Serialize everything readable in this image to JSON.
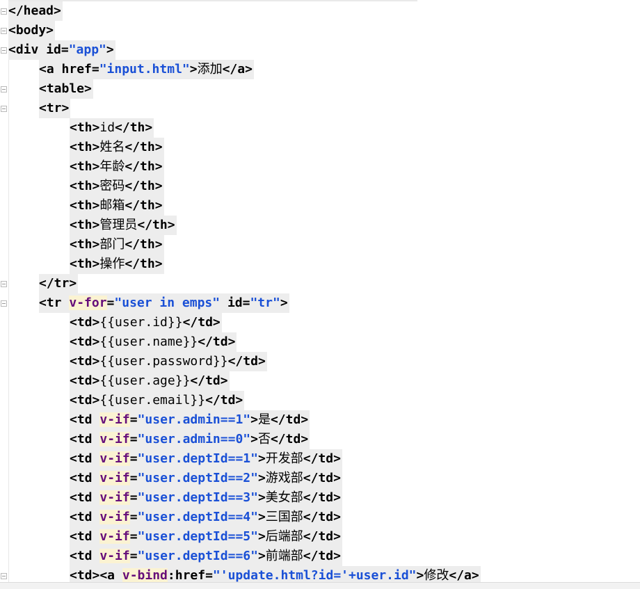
{
  "lines": [
    {
      "indent": 0,
      "parts": [
        [
          "tagk",
          "</head>"
        ]
      ]
    },
    {
      "indent": 0,
      "parts": [
        [
          "tagk",
          "<body>"
        ]
      ]
    },
    {
      "indent": 0,
      "parts": [
        [
          "tagk",
          "<div "
        ],
        [
          "tagk",
          "id="
        ],
        [
          "strb",
          "\"app\""
        ],
        [
          "tagk",
          ">"
        ]
      ]
    },
    {
      "indent": 1,
      "parts": [
        [
          "tagk",
          "<a "
        ],
        [
          "tagk",
          "href="
        ],
        [
          "strb",
          "\"input.html\""
        ],
        [
          "tagk",
          ">"
        ],
        [
          "txt",
          "添加"
        ],
        [
          "tagk",
          "</a>"
        ]
      ]
    },
    {
      "indent": 1,
      "parts": [
        [
          "tagk",
          "<table>"
        ]
      ]
    },
    {
      "indent": 1,
      "parts": [
        [
          "tagk",
          "<tr>"
        ]
      ]
    },
    {
      "indent": 2,
      "parts": [
        [
          "tagk",
          "<th>"
        ],
        [
          "txt",
          "id"
        ],
        [
          "tagk",
          "</th>"
        ]
      ]
    },
    {
      "indent": 2,
      "parts": [
        [
          "tagk",
          "<th>"
        ],
        [
          "txt",
          "姓名"
        ],
        [
          "tagk",
          "</th>"
        ]
      ]
    },
    {
      "indent": 2,
      "parts": [
        [
          "tagk",
          "<th>"
        ],
        [
          "txt",
          "年龄"
        ],
        [
          "tagk",
          "</th>"
        ]
      ]
    },
    {
      "indent": 2,
      "parts": [
        [
          "tagk",
          "<th>"
        ],
        [
          "txt",
          "密码"
        ],
        [
          "tagk",
          "</th>"
        ]
      ]
    },
    {
      "indent": 2,
      "parts": [
        [
          "tagk",
          "<th>"
        ],
        [
          "txt",
          "邮箱"
        ],
        [
          "tagk",
          "</th>"
        ]
      ]
    },
    {
      "indent": 2,
      "parts": [
        [
          "tagk",
          "<th>"
        ],
        [
          "txt",
          "管理员"
        ],
        [
          "tagk",
          "</th>"
        ]
      ]
    },
    {
      "indent": 2,
      "parts": [
        [
          "tagk",
          "<th>"
        ],
        [
          "txt",
          "部门"
        ],
        [
          "tagk",
          "</th>"
        ]
      ]
    },
    {
      "indent": 2,
      "parts": [
        [
          "tagk",
          "<th>"
        ],
        [
          "txt",
          "操作"
        ],
        [
          "tagk",
          "</th>"
        ]
      ]
    },
    {
      "indent": 1,
      "parts": [
        [
          "tagk",
          "</tr>"
        ]
      ]
    },
    {
      "indent": 1,
      "parts": [
        [
          "tagk",
          "<tr "
        ],
        [
          "vattr",
          "v-for"
        ],
        [
          "tagk",
          "="
        ],
        [
          "strb",
          "\"user in emps\""
        ],
        [
          "tagk",
          " id="
        ],
        [
          "strb",
          "\"tr\""
        ],
        [
          "tagk",
          ">"
        ]
      ]
    },
    {
      "indent": 2,
      "parts": [
        [
          "tagk",
          "<td>"
        ],
        [
          "txt",
          "{{user.id}}"
        ],
        [
          "tagk",
          "</td>"
        ]
      ]
    },
    {
      "indent": 2,
      "parts": [
        [
          "tagk",
          "<td>"
        ],
        [
          "txt",
          "{{user.name}}"
        ],
        [
          "tagk",
          "</td>"
        ]
      ]
    },
    {
      "indent": 2,
      "parts": [
        [
          "tagk",
          "<td>"
        ],
        [
          "txt",
          "{{user.password}}"
        ],
        [
          "tagk",
          "</td>"
        ]
      ]
    },
    {
      "indent": 2,
      "parts": [
        [
          "tagk",
          "<td>"
        ],
        [
          "txt",
          "{{user.age}}"
        ],
        [
          "tagk",
          "</td>"
        ]
      ]
    },
    {
      "indent": 2,
      "parts": [
        [
          "tagk",
          "<td>"
        ],
        [
          "txt",
          "{{user.email}}"
        ],
        [
          "tagk",
          "</td>"
        ]
      ]
    },
    {
      "indent": 2,
      "parts": [
        [
          "tagk",
          "<td "
        ],
        [
          "vattr",
          "v-if"
        ],
        [
          "tagk",
          "="
        ],
        [
          "strb",
          "\"user.admin==1\""
        ],
        [
          "tagk",
          ">"
        ],
        [
          "txt",
          "是"
        ],
        [
          "tagk",
          "</td>"
        ]
      ]
    },
    {
      "indent": 2,
      "parts": [
        [
          "tagk",
          "<td "
        ],
        [
          "vattr",
          "v-if"
        ],
        [
          "tagk",
          "="
        ],
        [
          "strb",
          "\"user.admin==0\""
        ],
        [
          "tagk",
          ">"
        ],
        [
          "txt",
          "否"
        ],
        [
          "tagk",
          "</td>"
        ]
      ]
    },
    {
      "indent": 2,
      "parts": [
        [
          "tagk",
          "<td "
        ],
        [
          "vattr",
          "v-if"
        ],
        [
          "tagk",
          "="
        ],
        [
          "strb",
          "\"user.deptId==1\""
        ],
        [
          "tagk",
          ">"
        ],
        [
          "txt",
          "开发部"
        ],
        [
          "tagk",
          "</td>"
        ]
      ]
    },
    {
      "indent": 2,
      "parts": [
        [
          "tagk",
          "<td "
        ],
        [
          "vattr",
          "v-if"
        ],
        [
          "tagk",
          "="
        ],
        [
          "strb",
          "\"user.deptId==2\""
        ],
        [
          "tagk",
          ">"
        ],
        [
          "txt",
          "游戏部"
        ],
        [
          "tagk",
          "</td>"
        ]
      ]
    },
    {
      "indent": 2,
      "parts": [
        [
          "tagk",
          "<td "
        ],
        [
          "vattr",
          "v-if"
        ],
        [
          "tagk",
          "="
        ],
        [
          "strb",
          "\"user.deptId==3\""
        ],
        [
          "tagk",
          ">"
        ],
        [
          "txt",
          "美女部"
        ],
        [
          "tagk",
          "</td>"
        ]
      ]
    },
    {
      "indent": 2,
      "parts": [
        [
          "tagk",
          "<td "
        ],
        [
          "vattr",
          "v-if"
        ],
        [
          "tagk",
          "="
        ],
        [
          "strb",
          "\"user.deptId==4\""
        ],
        [
          "tagk",
          ">"
        ],
        [
          "txt",
          "三国部"
        ],
        [
          "tagk",
          "</td>"
        ]
      ]
    },
    {
      "indent": 2,
      "parts": [
        [
          "tagk",
          "<td "
        ],
        [
          "vattr",
          "v-if"
        ],
        [
          "tagk",
          "="
        ],
        [
          "strb",
          "\"user.deptId==5\""
        ],
        [
          "tagk",
          ">"
        ],
        [
          "txt",
          "后端部"
        ],
        [
          "tagk",
          "</td>"
        ]
      ]
    },
    {
      "indent": 2,
      "parts": [
        [
          "tagk",
          "<td "
        ],
        [
          "vattr",
          "v-if"
        ],
        [
          "tagk",
          "="
        ],
        [
          "strb",
          "\"user.deptId==6\""
        ],
        [
          "tagk",
          ">"
        ],
        [
          "txt",
          "前端部"
        ],
        [
          "tagk",
          "</td>"
        ]
      ]
    },
    {
      "indent": 2,
      "parts": [
        [
          "tagk",
          "<td><a "
        ],
        [
          "vattr",
          "v-bind"
        ],
        [
          "tagk",
          ":href="
        ],
        [
          "strb",
          "\"'update.html?id='+user.id\""
        ],
        [
          "tagk",
          ">"
        ],
        [
          "txt",
          "修改"
        ],
        [
          "tagk",
          "</a>"
        ]
      ]
    }
  ],
  "colors": {
    "background": "#ffffff",
    "tag": "#000000",
    "string": "#1a50d6",
    "vue_directive": "#660e7a",
    "directive_highlight": "#fbf3d2",
    "line_highlight": "#ededed"
  }
}
